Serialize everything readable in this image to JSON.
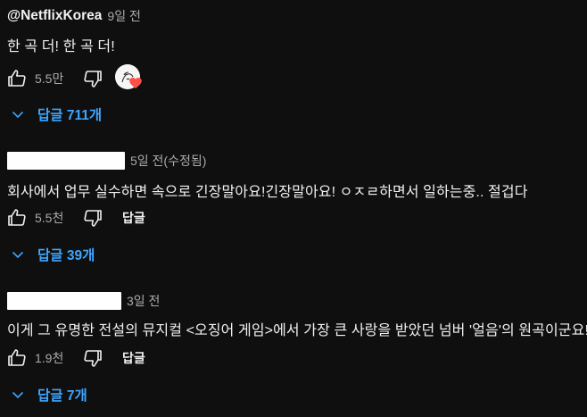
{
  "comments": [
    {
      "author": "@NetflixKorea",
      "time": "9일 전",
      "text": "한 곡 더! 한 곡 더!",
      "likes": "5.5만",
      "has_creator_heart": true,
      "reply_label": "",
      "replies_label": "답글 711개"
    },
    {
      "author": "",
      "author_redacted": true,
      "time": "5일 전(수정됨)",
      "text": "회사에서 업무 실수하면 속으로 긴장말아요!긴장말아요! ㅇㅈㄹ하면서 일하는중.. 절겁다",
      "likes": "5.5천",
      "has_creator_heart": false,
      "reply_label": "답글",
      "replies_label": "답글 39개"
    },
    {
      "author": "",
      "author_redacted": true,
      "time": "3일 전",
      "text": "이게 그 유명한 전설의 뮤지컬 <오징어 게임>에서 가장 큰 사랑을 받았던 넘버 '얼음'의 원곡이군요!",
      "likes": "1.9천",
      "has_creator_heart": false,
      "reply_label": "답글",
      "replies_label": "답글 7개"
    }
  ],
  "colors": {
    "background": "#0f0f0f",
    "text": "#f1f1f1",
    "muted": "#aaaaaa",
    "link": "#3ea6ff",
    "heart": "#ff4e45"
  },
  "icons": {
    "like": "thumbs-up-icon",
    "dislike": "thumbs-down-icon",
    "expand": "chevron-down-icon",
    "creator_heart": "creator-heart-icon"
  }
}
